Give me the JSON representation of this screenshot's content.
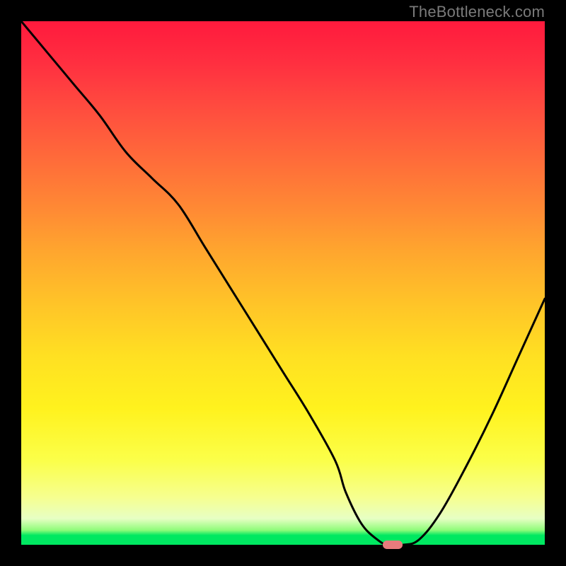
{
  "watermark": {
    "text": "TheBottleneck.com"
  },
  "chart_data": {
    "type": "line",
    "title": "",
    "xlabel": "",
    "ylabel": "",
    "xlim": [
      0,
      100
    ],
    "ylim": [
      0,
      100
    ],
    "grid": false,
    "legend": false,
    "background_gradient": {
      "direction": "vertical",
      "stops": [
        {
          "pos": 0,
          "color": "#ff1a3d"
        },
        {
          "pos": 0.4,
          "color": "#ff8a34"
        },
        {
          "pos": 0.74,
          "color": "#fff21e"
        },
        {
          "pos": 0.95,
          "color": "#e7ffc4"
        },
        {
          "pos": 1.0,
          "color": "#00e861"
        }
      ]
    },
    "series": [
      {
        "name": "bottleneck-curve",
        "color": "#000000",
        "x": [
          0,
          5,
          10,
          15,
          20,
          25,
          30,
          35,
          40,
          45,
          50,
          55,
          60,
          62,
          65,
          68,
          70,
          73,
          76,
          80,
          85,
          90,
          95,
          100
        ],
        "y": [
          100,
          94,
          88,
          82,
          75,
          70,
          65,
          57,
          49,
          41,
          33,
          25,
          16,
          10,
          4,
          1,
          0,
          0,
          1,
          6,
          15,
          25,
          36,
          47
        ]
      }
    ],
    "marker": {
      "name": "optimum-marker",
      "color": "#e87b7d",
      "x": 71,
      "y": 0,
      "width_pct": 3.8,
      "height_pct": 1.6
    }
  }
}
